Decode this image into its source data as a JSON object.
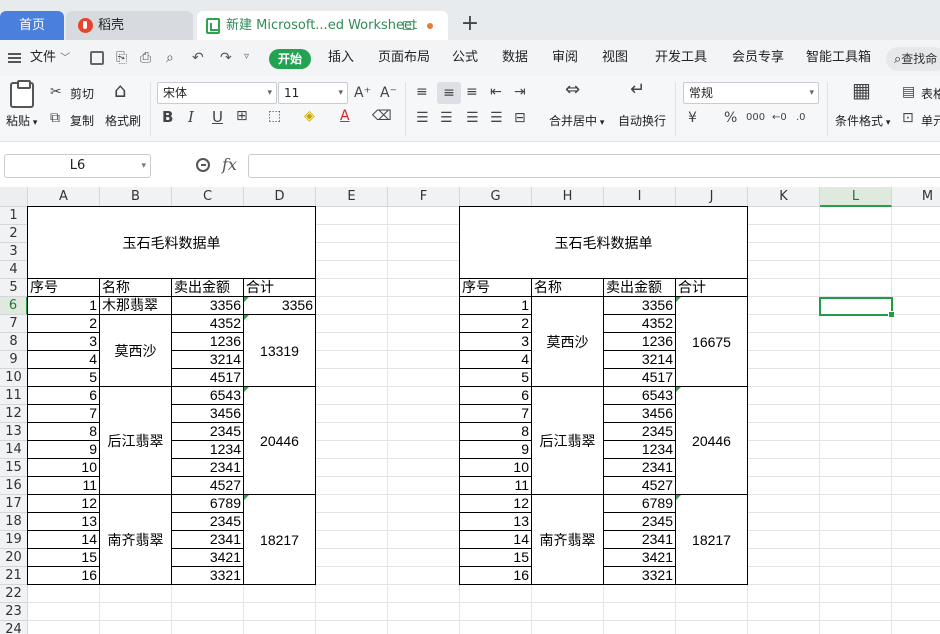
{
  "tabs": {
    "home": "首页",
    "docer": "稻壳",
    "sheet": "新建 Microsoft...ed Worksheet",
    "add": "+"
  },
  "menu": {
    "file": "文件",
    "start": "开始",
    "items": [
      "插入",
      "页面布局",
      "公式",
      "数据",
      "审阅",
      "视图",
      "开发工具",
      "会员专享",
      "智能工具箱"
    ],
    "search": "查找命"
  },
  "ribbon": {
    "paste": "粘贴",
    "cut": "剪切",
    "copy": "复制",
    "format_painter": "格式刷",
    "font_name": "宋体",
    "font_size": "11",
    "merge_center": "合并居中",
    "wrap_text": "自动换行",
    "number_format": "常规",
    "conditional_format": "条件格式",
    "table_style": "表格",
    "cell_style": "单元",
    "bold": "B",
    "italic": "I",
    "underline": "U",
    "currency": "¥",
    "percent": "%"
  },
  "formula_bar": {
    "name_box": "L6",
    "fx": "fx",
    "value": ""
  },
  "sheet": {
    "columns": [
      "A",
      "B",
      "C",
      "D",
      "E",
      "F",
      "G",
      "H",
      "I",
      "J",
      "K",
      "L",
      "M"
    ],
    "rows": [
      "1",
      "2",
      "3",
      "4",
      "5",
      "6",
      "7",
      "8",
      "9",
      "10",
      "11",
      "12",
      "13",
      "14",
      "15",
      "16",
      "17",
      "18",
      "19",
      "20",
      "21",
      "22",
      "23",
      "24"
    ],
    "selected_cell": "L6",
    "tables": [
      {
        "title": "玉石毛料数据单",
        "headers": [
          "序号",
          "名称",
          "卖出金额",
          "合计"
        ],
        "seq": [
          "1",
          "2",
          "3",
          "4",
          "5",
          "6",
          "7",
          "8",
          "9",
          "10",
          "11",
          "12",
          "13",
          "14",
          "15",
          "16"
        ],
        "amounts": [
          "3356",
          "4352",
          "1236",
          "3214",
          "4517",
          "6543",
          "3456",
          "2345",
          "1234",
          "2341",
          "4527",
          "6789",
          "2345",
          "2341",
          "3421",
          "3321"
        ],
        "groups": [
          {
            "name": "木那翡翠",
            "total": "3356"
          },
          {
            "name": "莫西沙",
            "total": "13319"
          },
          {
            "name": "后江翡翠",
            "total": "20446"
          },
          {
            "name": "南齐翡翠",
            "total": "18217"
          }
        ]
      },
      {
        "title": "玉石毛料数据单",
        "headers": [
          "序号",
          "名称",
          "卖出金额",
          "合计"
        ],
        "seq": [
          "1",
          "2",
          "3",
          "4",
          "5",
          "6",
          "7",
          "8",
          "9",
          "10",
          "11",
          "12",
          "13",
          "14",
          "15",
          "16"
        ],
        "amounts": [
          "3356",
          "4352",
          "1236",
          "3214",
          "4517",
          "6543",
          "3456",
          "2345",
          "1234",
          "2341",
          "4527",
          "6789",
          "2345",
          "2341",
          "3421",
          "3321"
        ],
        "groups": [
          {
            "name": "莫西沙",
            "total": "16675"
          },
          {
            "name": "后江翡翠",
            "total": "20446"
          },
          {
            "name": "南齐翡翠",
            "total": "18217"
          }
        ]
      }
    ]
  }
}
